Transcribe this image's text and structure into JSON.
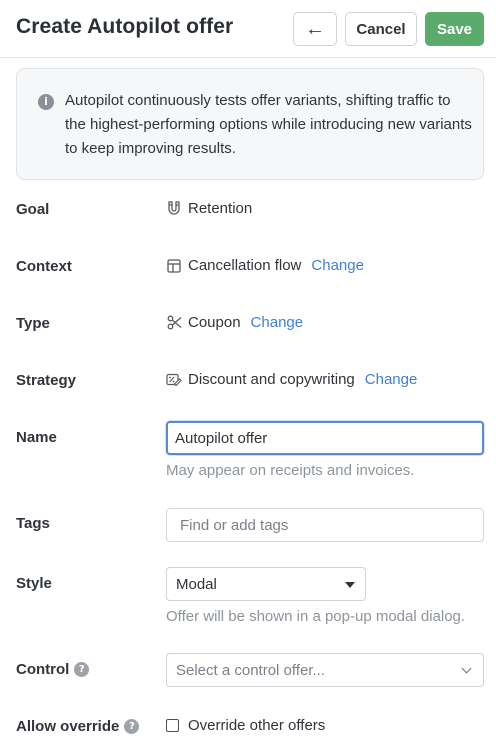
{
  "header": {
    "title": "Create Autopilot offer",
    "back_icon": "arrow-left-icon",
    "back_glyph": "←",
    "cancel_label": "Cancel",
    "save_label": "Save",
    "save_color": "#5aab6c"
  },
  "info": {
    "icon": "info-icon",
    "icon_glyph": "i",
    "text": "Autopilot continuously tests offer variants, shifting traffic to the highest-performing options while introducing new variants to keep improving results."
  },
  "fields": {
    "goal": {
      "label": "Goal",
      "icon": "magnet-icon",
      "value": "Retention"
    },
    "context": {
      "label": "Context",
      "icon": "layout-icon",
      "value": "Cancellation flow",
      "link": "Change"
    },
    "type": {
      "label": "Type",
      "icon": "scissors-icon",
      "value": "Coupon",
      "link": "Change"
    },
    "strategy": {
      "label": "Strategy",
      "icon": "discount-copy-icon",
      "value": "Discount and copywriting",
      "link": "Change"
    },
    "name": {
      "label": "Name",
      "value": "Autopilot offer",
      "hint": "May appear on receipts and invoices."
    },
    "tags": {
      "label": "Tags",
      "placeholder": "Find or add tags"
    },
    "style": {
      "label": "Style",
      "selected": "Modal",
      "hint": "Offer will be shown in a pop-up modal dialog."
    },
    "control": {
      "label": "Control",
      "help_glyph": "?",
      "placeholder": "Select a control offer..."
    },
    "allow_override": {
      "label": "Allow override",
      "help_glyph": "?",
      "checkbox_label": "Override other offers",
      "checked": false
    }
  },
  "colors": {
    "link": "#3f7fd6",
    "focus_border": "#5b87d8"
  }
}
